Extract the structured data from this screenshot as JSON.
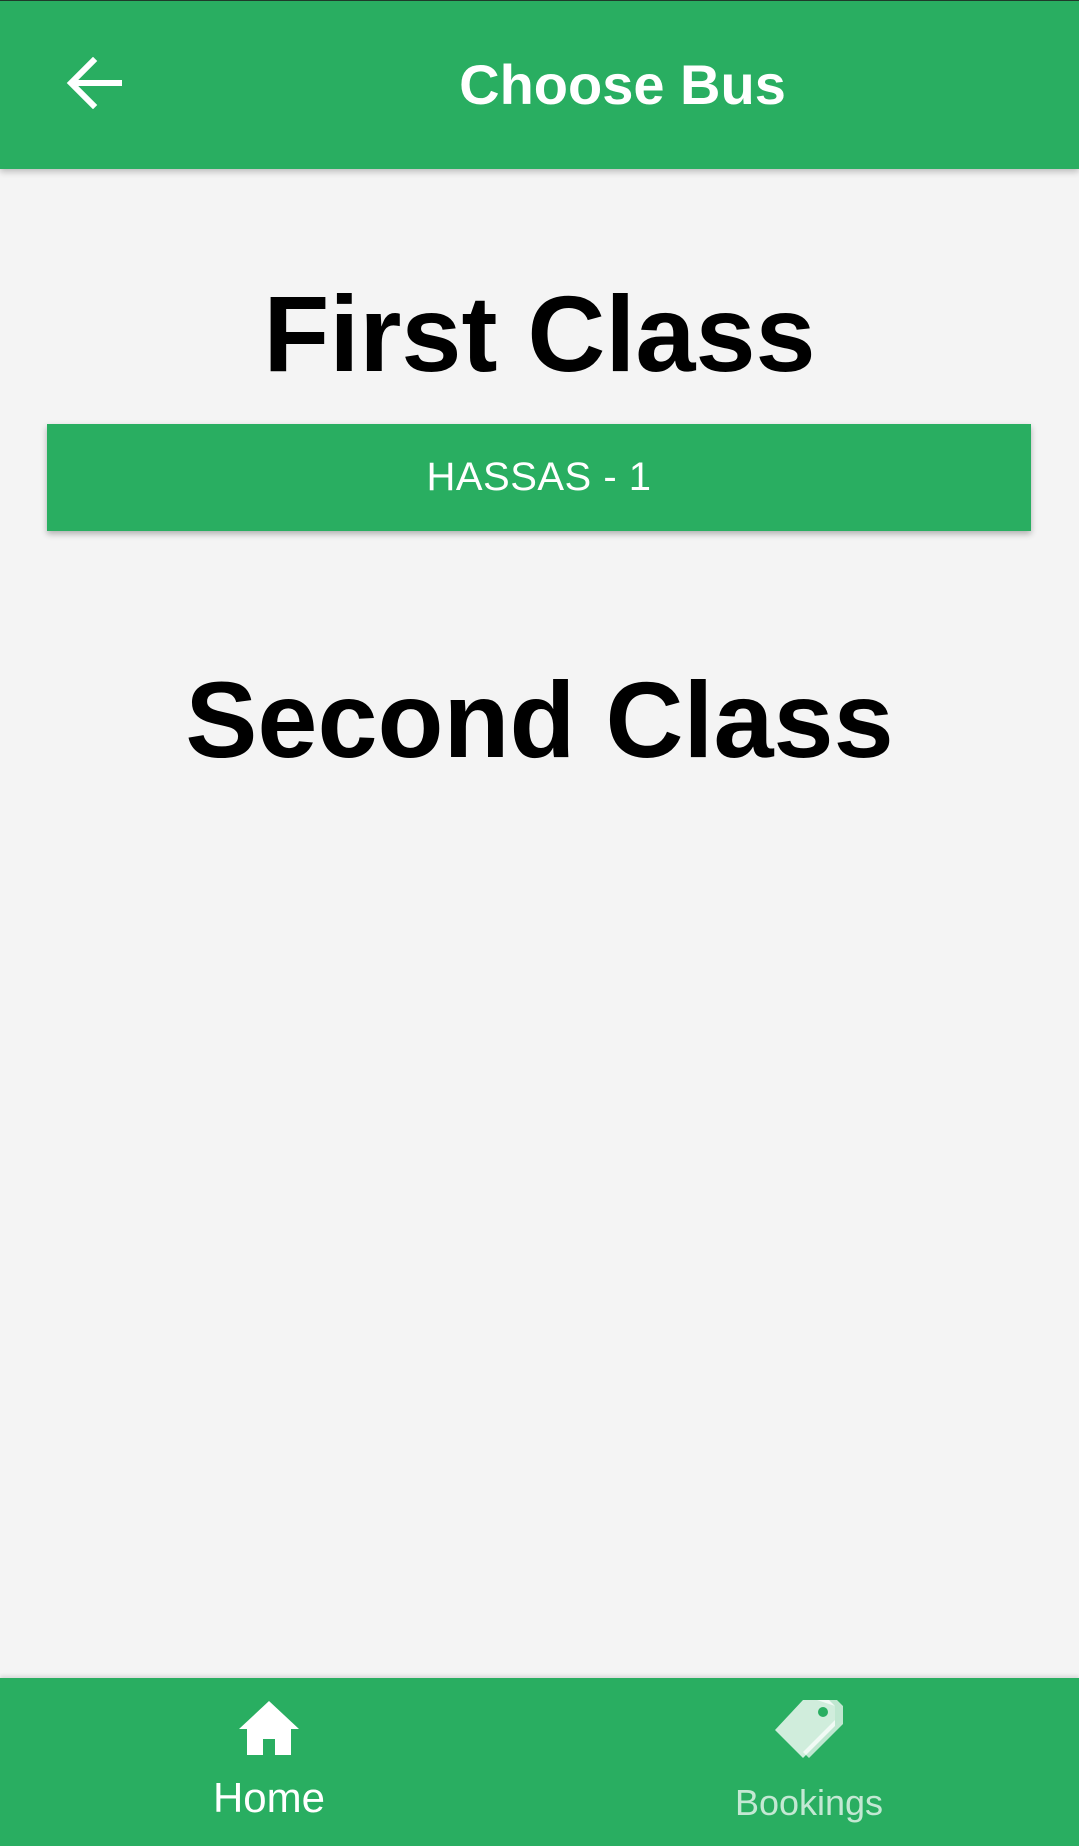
{
  "app_bar": {
    "title": "Choose Bus",
    "back_icon": "arrow-left-icon",
    "color": "#29ae61"
  },
  "sections": [
    {
      "title": "First Class",
      "buses": [
        {
          "label": "HASSAS - 1"
        }
      ]
    },
    {
      "title": "Second Class",
      "buses": []
    }
  ],
  "bottom_nav": {
    "items": [
      {
        "label": "Home",
        "icon": "home-icon",
        "active": true
      },
      {
        "label": "Bookings",
        "icon": "tags-icon",
        "active": false
      }
    ]
  },
  "colors": {
    "accent": "#29ae61",
    "background": "#f4f4f4",
    "text": "#000000"
  }
}
